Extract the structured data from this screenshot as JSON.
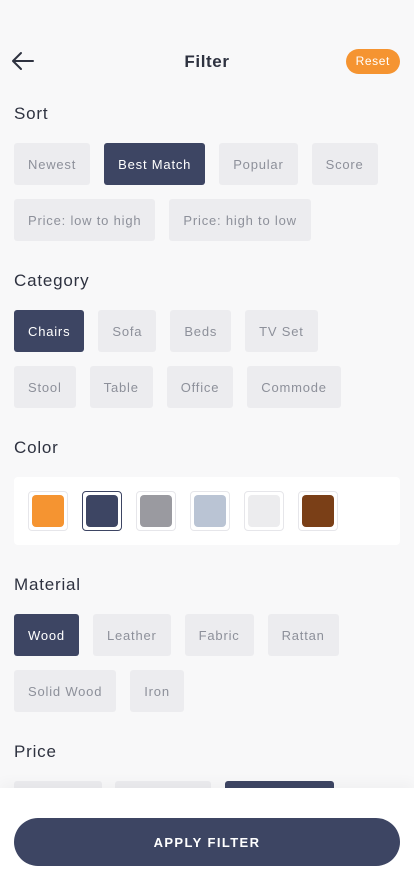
{
  "header": {
    "title": "Filter",
    "reset_label": "Reset",
    "back_icon": "arrow-left-icon"
  },
  "sort": {
    "title": "Sort",
    "options": [
      "Newest",
      "Best Match",
      "Popular",
      "Score",
      "Price: low to high",
      "Price: high to low"
    ],
    "selected": "Best Match"
  },
  "category": {
    "title": "Category",
    "options": [
      "Chairs",
      "Sofa",
      "Beds",
      "TV Set",
      "Stool",
      "Table",
      "Office",
      "Commode"
    ],
    "selected": "Chairs"
  },
  "color": {
    "title": "Color",
    "swatches": [
      "#f59431",
      "#3d4563",
      "#9a9aa0",
      "#bac4d4",
      "#ececee",
      "#7a3f17"
    ],
    "selected_index": 1
  },
  "material": {
    "title": "Material",
    "options": [
      "Wood",
      "Leather",
      "Fabric",
      "Rattan",
      "Solid Wood",
      "Iron"
    ],
    "selected": "Wood"
  },
  "price": {
    "title": "Price"
  },
  "footer": {
    "apply_label": "APPLY FILTER"
  },
  "theme": {
    "accent": "#f59431",
    "primary": "#3d4563",
    "chip_bg": "#ececef",
    "background": "#f8f8f9"
  }
}
